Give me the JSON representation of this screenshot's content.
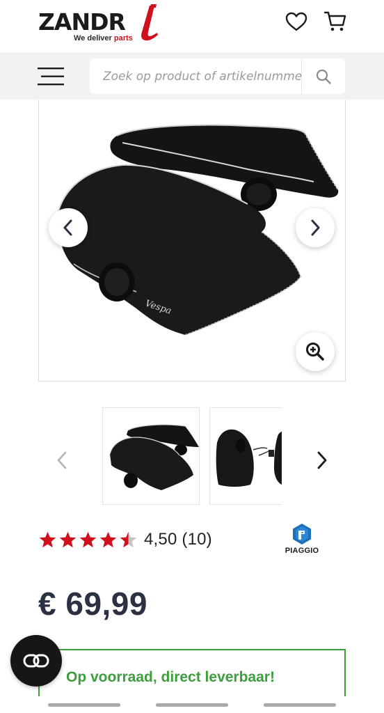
{
  "header": {
    "logo_word": "ZANDR",
    "logo_tagline_prefix": "We deliver ",
    "logo_tagline_accent": "parts",
    "brand_red": "#d0101c",
    "icons": [
      "heart-icon",
      "cart-icon"
    ]
  },
  "search": {
    "placeholder": "Zoek op product of artikelnummer",
    "menu_icon": "hamburger-icon",
    "search_icon": "magnifier-icon"
  },
  "gallery": {
    "main_image_alt": "Vespa handmoffen",
    "prev_icon": "chevron-left-icon",
    "next_icon": "chevron-right-icon",
    "zoom_icon": "zoom-in-icon",
    "thumbnails": [
      "thumbnail-1",
      "thumbnail-2"
    ]
  },
  "rating": {
    "stars": 4.5,
    "max_stars": 5,
    "text": "4,50 (10)",
    "star_color": "#d0101c"
  },
  "brand": {
    "name": "PIAGGIO",
    "color": "#1d6fb8"
  },
  "price": {
    "text": "€ 69,99"
  },
  "stock": {
    "text": "Op voorraad, direct leverbaar!",
    "color": "#3d9e3d"
  },
  "chat": {
    "icon": "chat-toggle-icon"
  }
}
